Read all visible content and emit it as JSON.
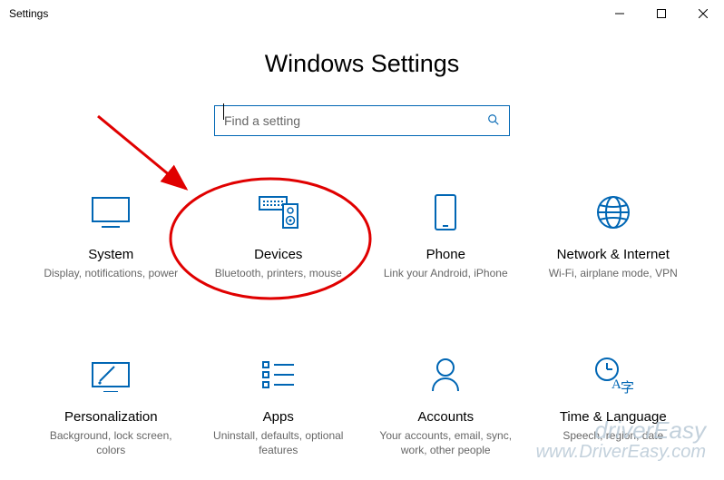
{
  "titlebar": {
    "title": "Settings"
  },
  "page": {
    "heading": "Windows Settings"
  },
  "search": {
    "placeholder": "Find a setting"
  },
  "tiles": [
    {
      "title": "System",
      "desc": "Display, notifications, power"
    },
    {
      "title": "Devices",
      "desc": "Bluetooth, printers, mouse"
    },
    {
      "title": "Phone",
      "desc": "Link your Android, iPhone"
    },
    {
      "title": "Network & Internet",
      "desc": "Wi-Fi, airplane mode, VPN"
    },
    {
      "title": "Personalization",
      "desc": "Background, lock screen, colors"
    },
    {
      "title": "Apps",
      "desc": "Uninstall, defaults, optional features"
    },
    {
      "title": "Accounts",
      "desc": "Your accounts, email, sync, work, other people"
    },
    {
      "title": "Time & Language",
      "desc": "Speech, region, date"
    }
  ],
  "watermark": {
    "line1": "driverEasy",
    "line2": "www.DriverEasy.com"
  },
  "colors": {
    "accent": "#0066b4",
    "annotation": "#e00000"
  }
}
